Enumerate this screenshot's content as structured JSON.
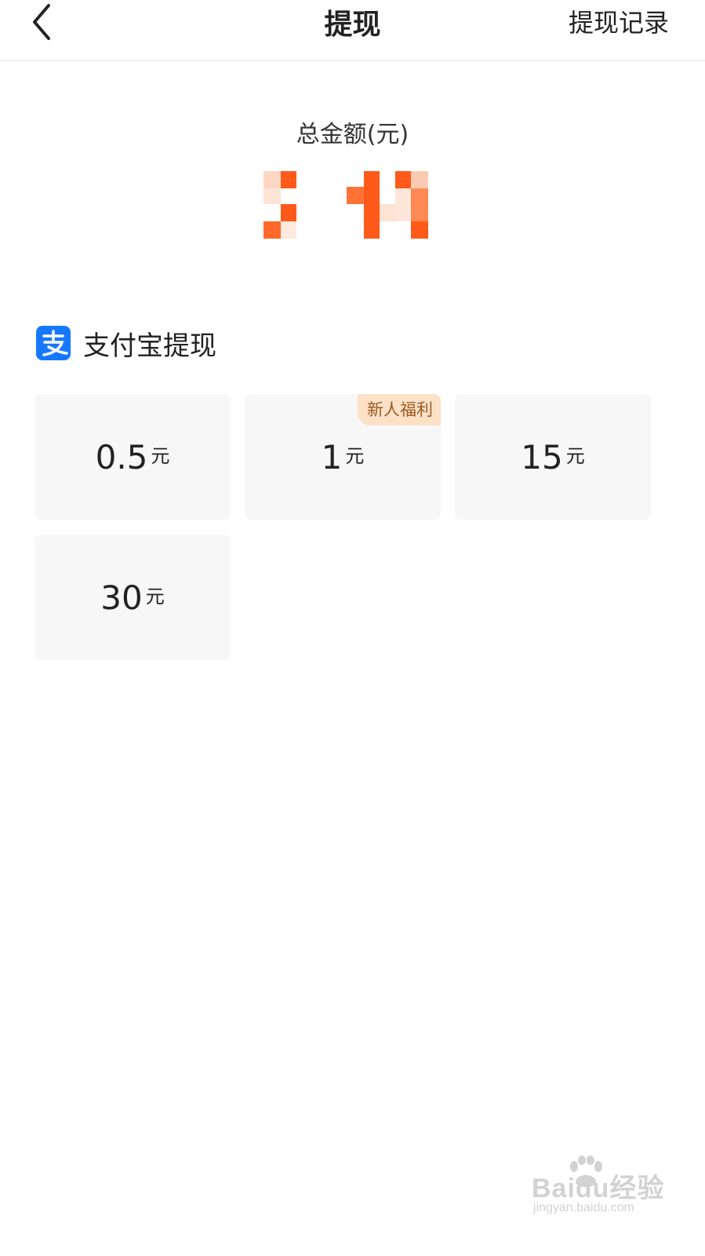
{
  "header": {
    "title": "提现",
    "records_label": "提现记录"
  },
  "balance": {
    "label": "总金额(元)",
    "accent_color": "#ff5a1a"
  },
  "method": {
    "icon": "alipay-icon",
    "label": "支付宝提现",
    "icon_color": "#1678ff"
  },
  "options": [
    {
      "value": "0.5",
      "unit": "元"
    },
    {
      "value": "1",
      "unit": "元",
      "badge": "新人福利"
    },
    {
      "value": "15",
      "unit": "元"
    },
    {
      "value": "30",
      "unit": "元"
    }
  ],
  "watermark": {
    "brand": "Baidu经验",
    "url": "jingyan.baidu.com"
  }
}
